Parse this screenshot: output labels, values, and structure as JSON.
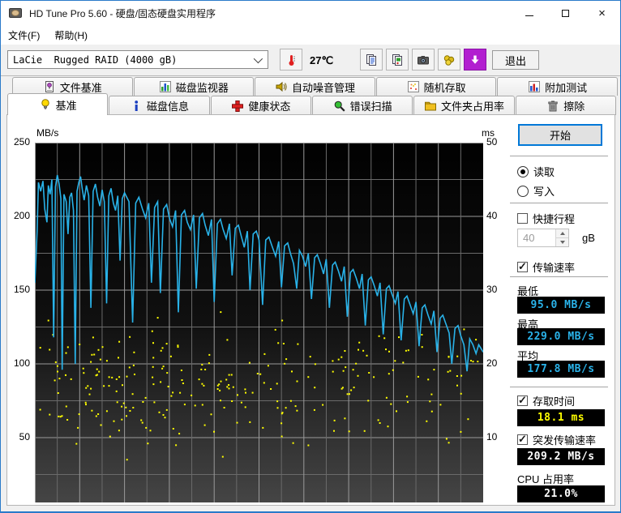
{
  "window": {
    "title": "HD Tune Pro 5.60 - 硬盘/固态硬盘实用程序"
  },
  "menu": {
    "items": [
      {
        "label": "文件(F)"
      },
      {
        "label": "帮助(H)"
      }
    ]
  },
  "toolbar": {
    "drive_selector": "LaCie  Rugged RAID (4000 gB)",
    "temperature": "27℃",
    "exit_label": "退出"
  },
  "tabs": {
    "row1": [
      {
        "label": "文件基准",
        "icon": "file-benchmark-icon"
      },
      {
        "label": "磁盘监视器",
        "icon": "disk-monitor-icon"
      },
      {
        "label": "自动噪音管理",
        "icon": "aam-icon"
      },
      {
        "label": "随机存取",
        "icon": "random-access-icon"
      },
      {
        "label": "附加测试",
        "icon": "extra-tests-icon"
      }
    ],
    "row2": [
      {
        "label": "基准",
        "icon": "benchmark-icon",
        "active": true
      },
      {
        "label": "磁盘信息",
        "icon": "disk-info-icon"
      },
      {
        "label": "健康状态",
        "icon": "health-icon"
      },
      {
        "label": "错误扫描",
        "icon": "error-scan-icon"
      },
      {
        "label": "文件夹占用率",
        "icon": "folder-usage-icon"
      },
      {
        "label": "擦除",
        "icon": "erase-icon"
      }
    ]
  },
  "panel": {
    "start_button": "开始",
    "read_label": "读取",
    "write_label": "写入",
    "read_selected": true,
    "short_stroke_label": "快捷行程",
    "short_stroke_checked": false,
    "short_stroke_value": "40",
    "short_stroke_unit": "gB",
    "transfer_rate_label": "传输速率",
    "transfer_rate_checked": true,
    "min_label": "最低",
    "min_value": "95.0 MB/s",
    "max_label": "最高",
    "max_value": "229.0 MB/s",
    "avg_label": "平均",
    "avg_value": "177.8 MB/s",
    "access_time_label": "存取时间",
    "access_time_checked": true,
    "access_time_value": "18.1 ms",
    "burst_label": "突发传输速率",
    "burst_checked": true,
    "burst_value": "209.2 MB/s",
    "cpu_label": "CPU 占用率",
    "cpu_value": "21.0%"
  },
  "colors": {
    "accent_border": "#0078d7",
    "lcd_speed": "#2ab3ea",
    "lcd_time": "#ffff00",
    "lcd_plain": "#ffffff",
    "curve": "#29b2e8",
    "scatter": "#ffff00",
    "plot_bg_top": "#010101",
    "plot_bg_bottom": "#454545",
    "grid_major": "#9a9a9a",
    "grid_minor": "#6a6a6a"
  },
  "chart_data": {
    "type": "line",
    "title": "",
    "left_axis": {
      "label": "MB/s",
      "min": 0,
      "max": 250,
      "ticks": [
        250,
        200,
        150,
        100,
        50
      ]
    },
    "right_axis": {
      "label": "ms",
      "min": 0,
      "max": 50,
      "ticks": [
        50,
        40,
        30,
        20,
        10
      ]
    },
    "x_divisions": 20,
    "grid": true,
    "legend": "none",
    "series": [
      {
        "name": "transfer-rate",
        "unit": "MB/s",
        "axis": "left",
        "points": [
          [
            0,
            155
          ],
          [
            0.005,
            190
          ],
          [
            0.008,
            223
          ],
          [
            0.013,
            217
          ],
          [
            0.018,
            224
          ],
          [
            0.022,
            205
          ],
          [
            0.027,
            196
          ],
          [
            0.03,
            221
          ],
          [
            0.034,
            215
          ],
          [
            0.038,
            225
          ],
          [
            0.042,
            118
          ],
          [
            0.046,
            220
          ],
          [
            0.05,
            228
          ],
          [
            0.054,
            222
          ],
          [
            0.058,
            212
          ],
          [
            0.061,
            96
          ],
          [
            0.065,
            215
          ],
          [
            0.07,
            210
          ],
          [
            0.074,
            188
          ],
          [
            0.078,
            213
          ],
          [
            0.082,
            216
          ],
          [
            0.086,
            204
          ],
          [
            0.09,
            100
          ],
          [
            0.094,
            217
          ],
          [
            0.098,
            223
          ],
          [
            0.102,
            227
          ],
          [
            0.106,
            218
          ],
          [
            0.11,
            211
          ],
          [
            0.115,
            221
          ],
          [
            0.12,
            214
          ],
          [
            0.125,
            138
          ],
          [
            0.13,
            217
          ],
          [
            0.135,
            222
          ],
          [
            0.14,
            213
          ],
          [
            0.145,
            207
          ],
          [
            0.15,
            218
          ],
          [
            0.155,
            210
          ],
          [
            0.16,
            141
          ],
          [
            0.165,
            214
          ],
          [
            0.17,
            219
          ],
          [
            0.175,
            209
          ],
          [
            0.18,
            204
          ],
          [
            0.185,
            214
          ],
          [
            0.19,
            170
          ],
          [
            0.195,
            212
          ],
          [
            0.2,
            216
          ],
          [
            0.21,
            210
          ],
          [
            0.218,
            128
          ],
          [
            0.225,
            209
          ],
          [
            0.232,
            213
          ],
          [
            0.24,
            205
          ],
          [
            0.247,
            199
          ],
          [
            0.254,
            209
          ],
          [
            0.26,
            155
          ],
          [
            0.267,
            206
          ],
          [
            0.274,
            210
          ],
          [
            0.28,
            148
          ],
          [
            0.287,
            205
          ],
          [
            0.294,
            208
          ],
          [
            0.3,
            199
          ],
          [
            0.307,
            193
          ],
          [
            0.314,
            204
          ],
          [
            0.32,
            135
          ],
          [
            0.327,
            201
          ],
          [
            0.334,
            204
          ],
          [
            0.34,
            196
          ],
          [
            0.347,
            191
          ],
          [
            0.354,
            201
          ],
          [
            0.36,
            151
          ],
          [
            0.367,
            199
          ],
          [
            0.374,
            202
          ],
          [
            0.38,
            194
          ],
          [
            0.387,
            187
          ],
          [
            0.394,
            198
          ],
          [
            0.4,
            142
          ],
          [
            0.407,
            195
          ],
          [
            0.414,
            198
          ],
          [
            0.42,
            191
          ],
          [
            0.427,
            185
          ],
          [
            0.434,
            195
          ],
          [
            0.44,
            160
          ],
          [
            0.447,
            192
          ],
          [
            0.454,
            194
          ],
          [
            0.46,
            187
          ],
          [
            0.467,
            179
          ],
          [
            0.474,
            190
          ],
          [
            0.48,
            150
          ],
          [
            0.487,
            188
          ],
          [
            0.494,
            190
          ],
          [
            0.5,
            184
          ],
          [
            0.508,
            140
          ],
          [
            0.515,
            184
          ],
          [
            0.522,
            186
          ],
          [
            0.53,
            179
          ],
          [
            0.537,
            173
          ],
          [
            0.544,
            183
          ],
          [
            0.55,
            152
          ],
          [
            0.557,
            180
          ],
          [
            0.564,
            182
          ],
          [
            0.57,
            175
          ],
          [
            0.577,
            168
          ],
          [
            0.584,
            151
          ],
          [
            0.59,
            177
          ],
          [
            0.597,
            173
          ],
          [
            0.604,
            166
          ],
          [
            0.61,
            175
          ],
          [
            0.617,
            144
          ],
          [
            0.624,
            172
          ],
          [
            0.63,
            174
          ],
          [
            0.637,
            168
          ],
          [
            0.644,
            161
          ],
          [
            0.65,
            171
          ],
          [
            0.657,
            138
          ],
          [
            0.664,
            167
          ],
          [
            0.67,
            169
          ],
          [
            0.677,
            163
          ],
          [
            0.684,
            156
          ],
          [
            0.69,
            166
          ],
          [
            0.697,
            132
          ],
          [
            0.704,
            162
          ],
          [
            0.71,
            164
          ],
          [
            0.717,
            158
          ],
          [
            0.724,
            151
          ],
          [
            0.73,
            161
          ],
          [
            0.737,
            126
          ],
          [
            0.744,
            157
          ],
          [
            0.75,
            159
          ],
          [
            0.757,
            153
          ],
          [
            0.764,
            146
          ],
          [
            0.77,
            155
          ],
          [
            0.777,
            120
          ],
          [
            0.784,
            151
          ],
          [
            0.79,
            153
          ],
          [
            0.797,
            147
          ],
          [
            0.804,
            141
          ],
          [
            0.81,
            149
          ],
          [
            0.817,
            116
          ],
          [
            0.824,
            144
          ],
          [
            0.83,
            146
          ],
          [
            0.837,
            140
          ],
          [
            0.844,
            134
          ],
          [
            0.85,
            142
          ],
          [
            0.857,
            112
          ],
          [
            0.864,
            138
          ],
          [
            0.87,
            140
          ],
          [
            0.877,
            133
          ],
          [
            0.884,
            127
          ],
          [
            0.89,
            136
          ],
          [
            0.897,
            108
          ],
          [
            0.904,
            131
          ],
          [
            0.91,
            133
          ],
          [
            0.917,
            127
          ],
          [
            0.924,
            121
          ],
          [
            0.93,
            100
          ],
          [
            0.937,
            124
          ],
          [
            0.944,
            126
          ],
          [
            0.95,
            119
          ],
          [
            0.957,
            113
          ],
          [
            0.964,
            95
          ],
          [
            0.97,
            117
          ],
          [
            0.977,
            113
          ],
          [
            0.984,
            107
          ],
          [
            0.99,
            113
          ],
          [
            0.996,
            110
          ],
          [
            1,
            108
          ]
        ],
        "summary": {
          "min": 95.0,
          "max": 229.0,
          "avg": 177.8
        }
      },
      {
        "name": "access-time",
        "unit": "ms",
        "axis": "right",
        "style": "scatter",
        "scatter_spec": {
          "seed": 7,
          "count": 270,
          "ms_min": 2,
          "ms_max": 31,
          "ms_mean": 17
        },
        "summary": {
          "avg": 18.1
        }
      }
    ]
  }
}
